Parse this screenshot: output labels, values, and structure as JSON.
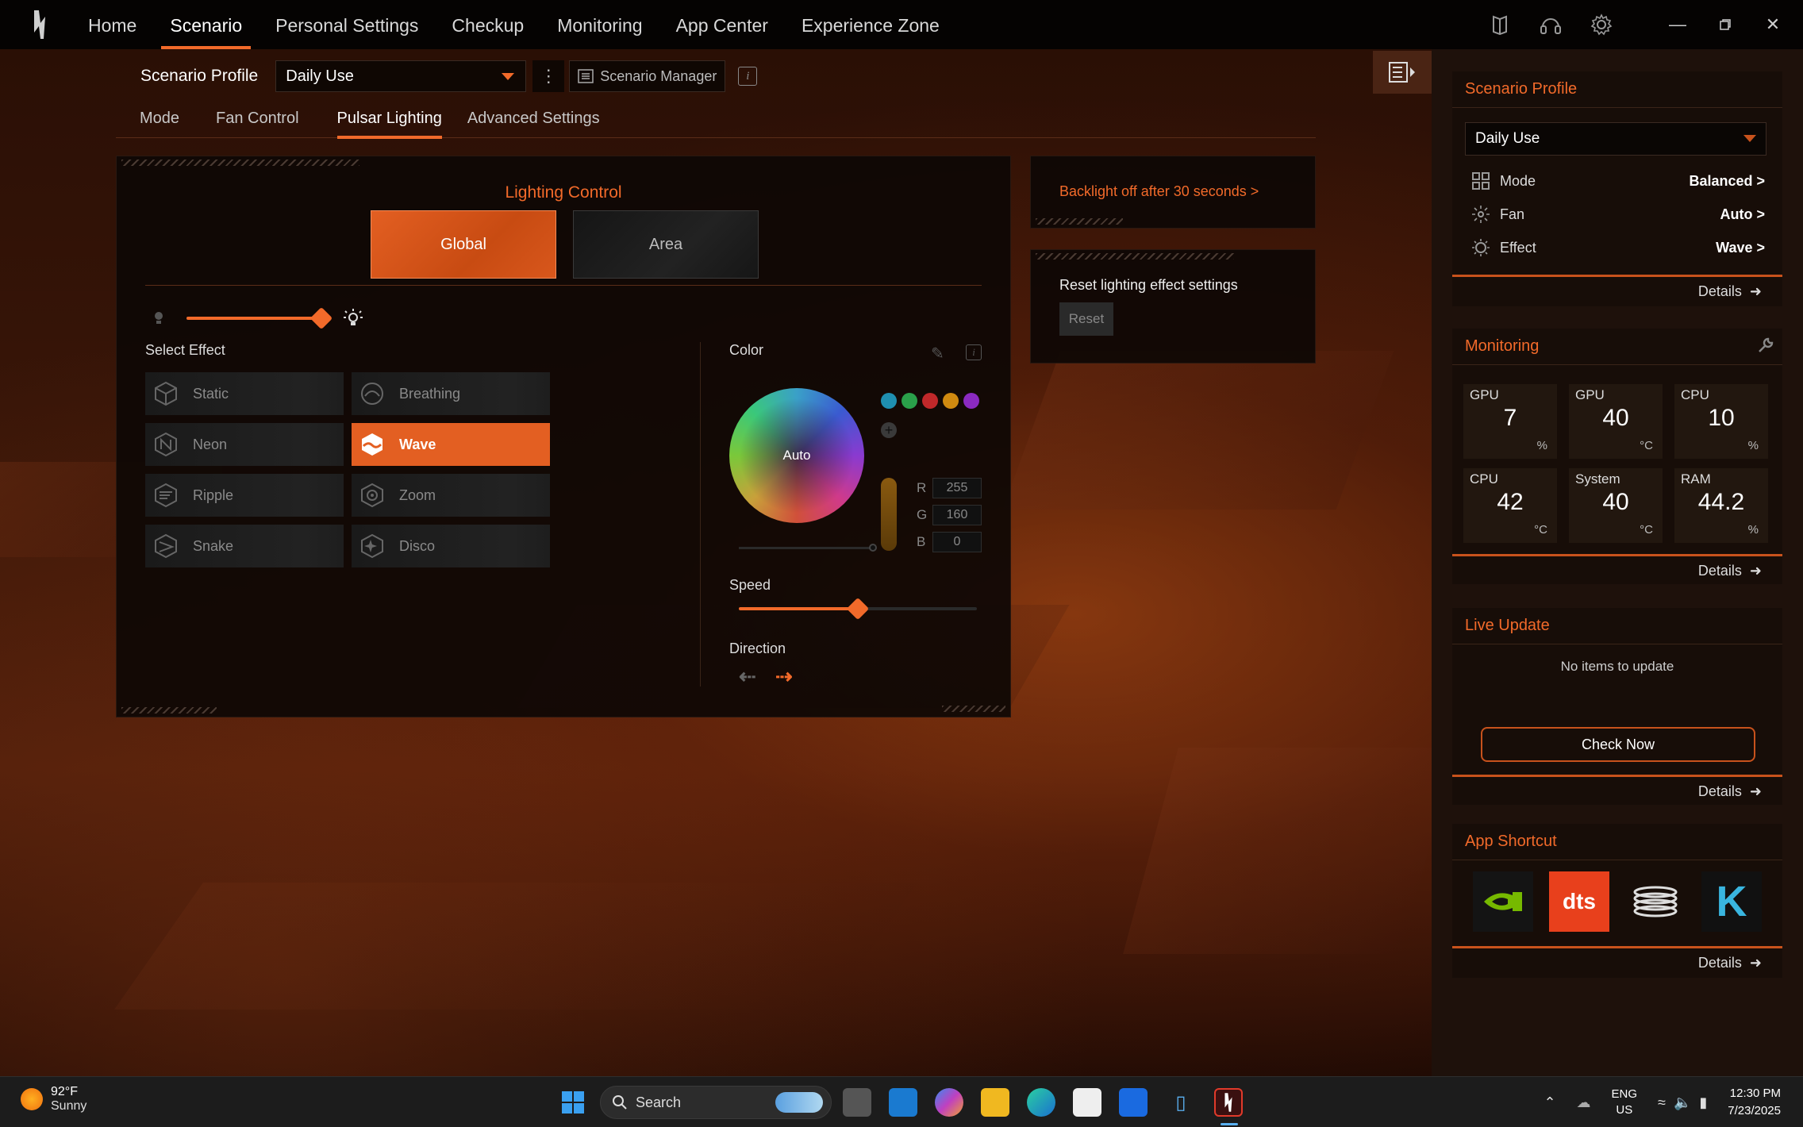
{
  "nav": {
    "items": [
      "Home",
      "Scenario",
      "Personal Settings",
      "Checkup",
      "Monitoring",
      "App Center",
      "Experience Zone"
    ],
    "active": "Scenario"
  },
  "profile": {
    "label": "Scenario Profile",
    "selected": "Daily Use",
    "manager_label": "Scenario Manager"
  },
  "subtabs": [
    "Mode",
    "Fan Control",
    "Pulsar Lighting",
    "Advanced Settings"
  ],
  "lighting": {
    "title": "Lighting Control",
    "global_label": "Global",
    "area_label": "Area",
    "brightness_percent": 100,
    "select_effect_label": "Select Effect",
    "effects": [
      "Static",
      "Breathing",
      "Neon",
      "Wave",
      "Ripple",
      "Zoom",
      "Snake",
      "Disco"
    ],
    "active_effect": "Wave",
    "color_label": "Color",
    "wheel_label": "Auto",
    "swatches": [
      "#1f8fb0",
      "#2aa04a",
      "#c0282a",
      "#d08a10",
      "#8a2ac0"
    ],
    "rgb": {
      "r_label": "R",
      "g_label": "G",
      "b_label": "B",
      "r": "255",
      "g": "160",
      "b": "0"
    },
    "speed_label": "Speed",
    "speed_percent": 50,
    "direction_label": "Direction"
  },
  "backlight": {
    "text": "Backlight off after 30 seconds >"
  },
  "reset": {
    "title": "Reset lighting effect settings",
    "button": "Reset"
  },
  "sidebar": {
    "scenario": {
      "title": "Scenario Profile",
      "selected": "Daily Use",
      "rows": [
        {
          "label": "Mode",
          "value": "Balanced >"
        },
        {
          "label": "Fan",
          "value": "Auto >"
        },
        {
          "label": "Effect",
          "value": "Wave >"
        }
      ],
      "details": "Details"
    },
    "monitoring": {
      "title": "Monitoring",
      "tiles": [
        {
          "label": "GPU",
          "value": "7",
          "unit": "%"
        },
        {
          "label": "GPU",
          "value": "40",
          "unit": "°C"
        },
        {
          "label": "CPU",
          "value": "10",
          "unit": "%"
        },
        {
          "label": "CPU",
          "value": "42",
          "unit": "°C"
        },
        {
          "label": "System",
          "value": "40",
          "unit": "°C"
        },
        {
          "label": "RAM",
          "value": "44.2",
          "unit": "%"
        }
      ],
      "details": "Details"
    },
    "live_update": {
      "title": "Live Update",
      "empty": "No items to update",
      "button": "Check Now",
      "details": "Details"
    },
    "app_shortcut": {
      "title": "App Shortcut",
      "dts_label": "dts",
      "k_label": "K",
      "details": "Details"
    }
  },
  "taskbar": {
    "temp": "92°F",
    "weather": "Sunny",
    "search": "Search",
    "lang1": "ENG",
    "lang2": "US",
    "time": "12:30 PM",
    "date": "7/23/2025"
  },
  "colors": {
    "accent": "#f26a2a"
  }
}
